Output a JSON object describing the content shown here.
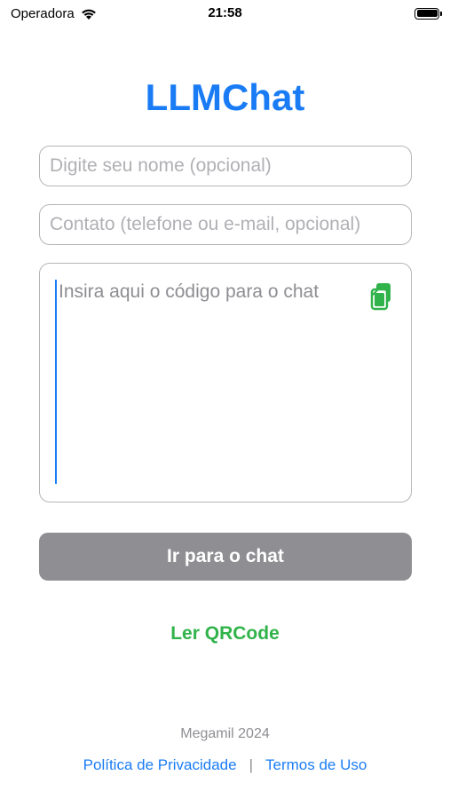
{
  "status_bar": {
    "carrier": "Operadora",
    "time": "21:58",
    "wifi_icon": "wifi-icon",
    "battery_icon": "battery-icon"
  },
  "app_title": "LLMChat",
  "form": {
    "name_placeholder": "Digite seu nome (opcional)",
    "name_value": "",
    "contact_placeholder": "Contato (telefone ou e-mail, opcional)",
    "contact_value": "",
    "code_placeholder": "Insira aqui o código para o chat",
    "code_value": "",
    "paste_icon": "paste-icon"
  },
  "go_button_label": "Ir para o chat",
  "qr_link_label": "Ler QRCode",
  "footer": {
    "copyright": "Megamil 2024",
    "privacy_label": "Política de Privacidade",
    "separator": "|",
    "terms_label": "Termos de Uso"
  },
  "colors": {
    "title": "#1a7cf5",
    "button_disabled": "#8e8e93",
    "qr_link": "#30b34a",
    "footer_link": "#1a7cf5"
  }
}
